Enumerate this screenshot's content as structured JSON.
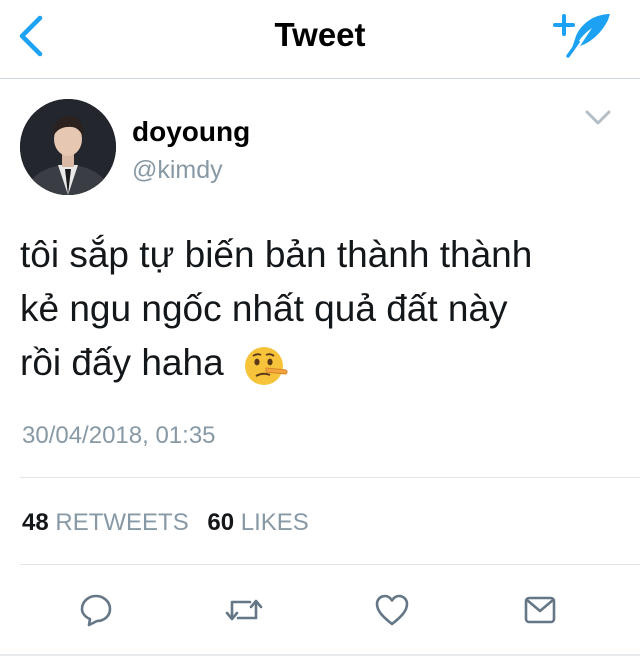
{
  "nav": {
    "title": "Tweet",
    "accent_color": "#1da1f2",
    "back_icon": "chevron-left-icon",
    "compose_icon": "compose-feather-icon"
  },
  "author": {
    "display_name": "doyoung",
    "handle": "@kimdy",
    "menu_icon": "chevron-down-icon"
  },
  "tweet": {
    "lines": [
      "tôi sắp tự biến bản thành thành",
      "kẻ ngu ngốc nhất quả đất này",
      "rồi đấy haha"
    ],
    "emoji": "lying-face-emoji",
    "timestamp": "30/04/2018, 01:35"
  },
  "stats": {
    "retweets_count": "48",
    "retweets_label": "RETWEETS",
    "likes_count": "60",
    "likes_label": "LIKES"
  },
  "actions": [
    {
      "name": "reply",
      "icon": "reply-icon"
    },
    {
      "name": "retweet",
      "icon": "retweet-icon"
    },
    {
      "name": "like",
      "icon": "heart-icon"
    },
    {
      "name": "share",
      "icon": "share-icon"
    }
  ],
  "colors": {
    "text_primary": "#14171a",
    "text_secondary": "#8899a6",
    "icon_gray": "#657786",
    "divider": "#e1e6ea"
  }
}
